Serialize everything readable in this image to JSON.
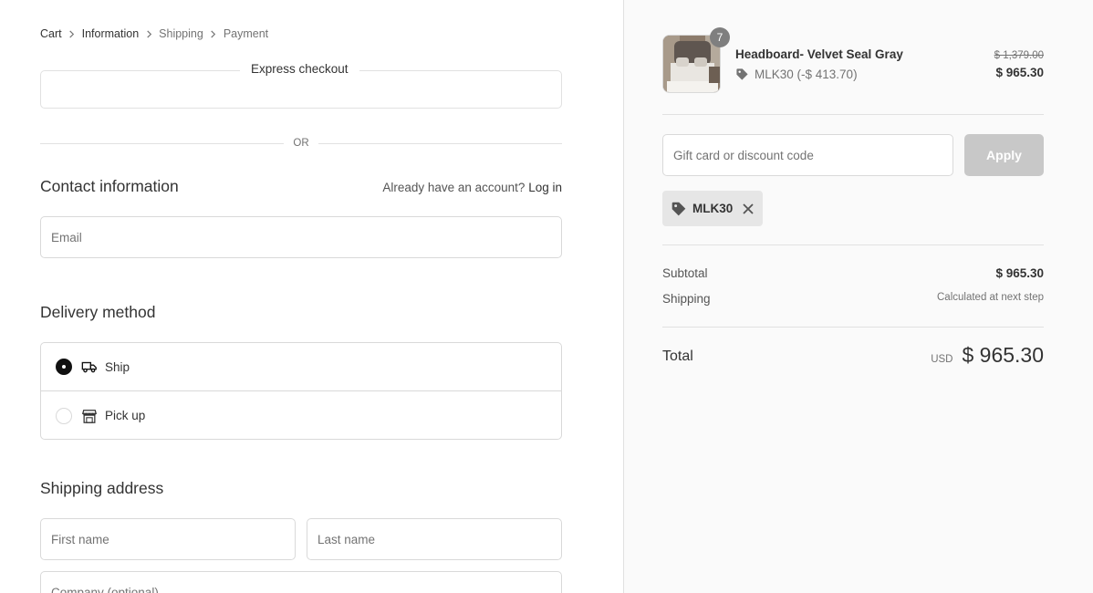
{
  "breadcrumb": {
    "items": [
      "Cart",
      "Information",
      "Shipping",
      "Payment"
    ]
  },
  "express": {
    "title": "Express checkout"
  },
  "divider": {
    "or": "OR"
  },
  "contact": {
    "title": "Contact information",
    "account_prompt": "Already have an account?",
    "login_label": "Log in",
    "email_placeholder": "Email"
  },
  "delivery": {
    "title": "Delivery method",
    "options": [
      {
        "label": "Ship",
        "icon": "truck-icon",
        "selected": true
      },
      {
        "label": "Pick up",
        "icon": "store-icon",
        "selected": false
      }
    ]
  },
  "shipping_address": {
    "title": "Shipping address",
    "first_name_placeholder": "First name",
    "last_name_placeholder": "Last name",
    "company_placeholder": "Company (optional)"
  },
  "summary": {
    "product": {
      "quantity": "7",
      "name": "Headboard- Velvet Seal Gray",
      "discount": "MLK30 (-$ 413.70)",
      "original_price": "$ 1,379.00",
      "price": "$ 965.30"
    },
    "discount_placeholder": "Gift card or discount code",
    "apply_label": "Apply",
    "applied_code": "MLK30",
    "subtotal_label": "Subtotal",
    "subtotal_value": "$ 965.30",
    "shipping_label": "Shipping",
    "shipping_value": "Calculated at next step",
    "total_label": "Total",
    "currency": "USD",
    "total_value": "$ 965.30"
  },
  "colors": {
    "apply_button_disabled": "#c8c8c8",
    "radio_selected": "#111111",
    "sidebar_bg": "#fafafa"
  }
}
